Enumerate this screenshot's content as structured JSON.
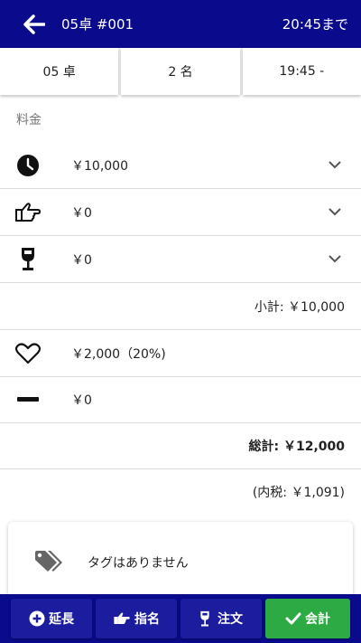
{
  "header": {
    "title": "05卓 #001",
    "until": "20:45まで",
    "back_icon": "arrow-left-icon"
  },
  "info": {
    "table": "05 卓",
    "guests": "2 名",
    "start": "19:45 -"
  },
  "fees": {
    "section_label": "料金",
    "time_charge": "￥10,000",
    "nomination": "￥0",
    "drinks": "￥0",
    "subtotal": "小計: ￥10,000",
    "service": "￥2,000（20%)",
    "discount": "￥0",
    "total": "総計: ￥12,000",
    "tax": "(内税: ￥1,091)"
  },
  "tags": {
    "empty_text": "タグはありません"
  },
  "bottom": {
    "extend": "延長",
    "nominate": "指名",
    "order": "注文",
    "checkout": "会計"
  },
  "colors": {
    "primary": "#0a0a8c",
    "button": "#1c1c9e",
    "checkout": "#2eaa44"
  }
}
